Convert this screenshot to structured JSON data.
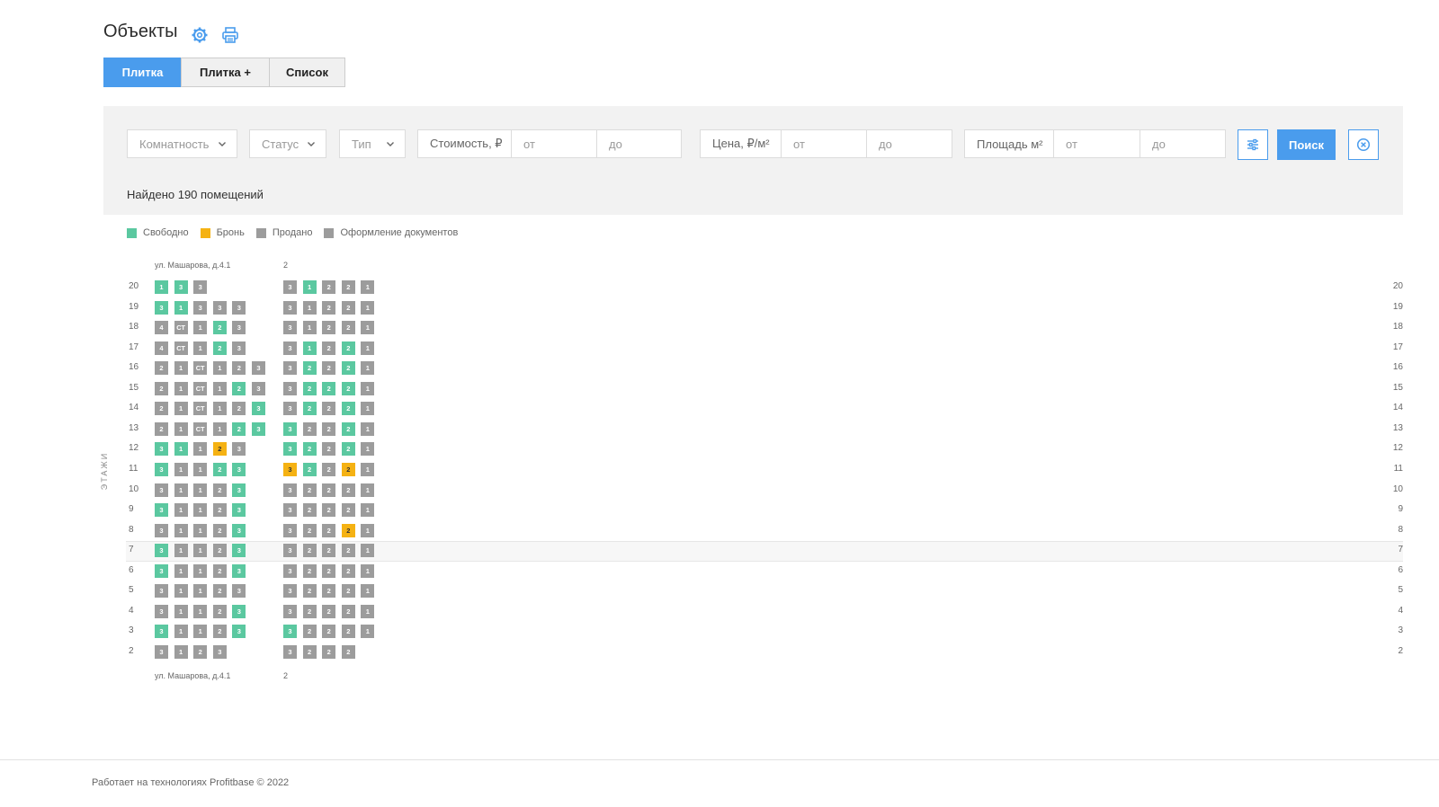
{
  "header": {
    "title": "Объекты",
    "icons": [
      "gear-icon",
      "printer-icon"
    ]
  },
  "tabs": [
    {
      "label": "Плитка",
      "active": true
    },
    {
      "label": "Плитка +",
      "active": false
    },
    {
      "label": "Список",
      "active": false
    }
  ],
  "filters": {
    "rooms": "Комнатность",
    "status": "Статус",
    "type": "Тип",
    "cost_label": "Стоимость, ₽",
    "cost_from": "от",
    "cost_to": "до",
    "price_label": "Цена, ₽/м²",
    "price_from": "от",
    "price_to": "до",
    "area_label": "Площадь м²",
    "area_from": "от",
    "area_to": "до",
    "search_button": "Поиск",
    "settings_icon": "sliders-icon",
    "reset_icon": "close-circle-icon"
  },
  "found_text": "Найдено 190 помещений",
  "legend": [
    {
      "label": "Свободно",
      "color": "#5bc8a0"
    },
    {
      "label": "Бронь",
      "color": "#f5b213"
    },
    {
      "label": "Продано",
      "color": "#9c9c9c"
    },
    {
      "label": "Оформление документов",
      "color": "#9c9c9c"
    }
  ],
  "colors": {
    "accent": "#4a9ced",
    "free": "#5bc8a0",
    "booked": "#f5b213",
    "sold": "#9c9c9c"
  },
  "board": {
    "axis_label": "ЭТАЖИ",
    "sections": [
      {
        "address": "ул. Машарова, д.4.1"
      },
      {
        "address": "2"
      }
    ],
    "floors": [
      {
        "floor": "20",
        "s1": [
          [
            "1",
            "F"
          ],
          [
            "3",
            "F"
          ],
          [
            "3",
            "S"
          ]
        ],
        "s2": [
          [
            "3",
            "S"
          ],
          [
            "1",
            "F"
          ],
          [
            "2",
            "S"
          ],
          [
            "2",
            "S"
          ],
          [
            "1",
            "S"
          ]
        ]
      },
      {
        "floor": "19",
        "s1": [
          [
            "3",
            "F"
          ],
          [
            "1",
            "F"
          ],
          [
            "3",
            "S"
          ],
          [
            "3",
            "S"
          ],
          [
            "3",
            "S"
          ]
        ],
        "s2": [
          [
            "3",
            "S"
          ],
          [
            "1",
            "S"
          ],
          [
            "2",
            "S"
          ],
          [
            "2",
            "S"
          ],
          [
            "1",
            "S"
          ]
        ]
      },
      {
        "floor": "18",
        "s1": [
          [
            "4",
            "S"
          ],
          [
            "СТ",
            "S"
          ],
          [
            "1",
            "S"
          ],
          [
            "2",
            "F"
          ],
          [
            "3",
            "S"
          ]
        ],
        "s2": [
          [
            "3",
            "S"
          ],
          [
            "1",
            "S"
          ],
          [
            "2",
            "S"
          ],
          [
            "2",
            "S"
          ],
          [
            "1",
            "S"
          ]
        ]
      },
      {
        "floor": "17",
        "s1": [
          [
            "4",
            "S"
          ],
          [
            "СТ",
            "S"
          ],
          [
            "1",
            "S"
          ],
          [
            "2",
            "F"
          ],
          [
            "3",
            "S"
          ]
        ],
        "s2": [
          [
            "3",
            "S"
          ],
          [
            "1",
            "F"
          ],
          [
            "2",
            "S"
          ],
          [
            "2",
            "F"
          ],
          [
            "1",
            "S"
          ]
        ]
      },
      {
        "floor": "16",
        "s1": [
          [
            "2",
            "S"
          ],
          [
            "1",
            "S"
          ],
          [
            "СТ",
            "S"
          ],
          [
            "1",
            "S"
          ],
          [
            "2",
            "S"
          ],
          [
            "3",
            "S"
          ]
        ],
        "s2": [
          [
            "3",
            "S"
          ],
          [
            "2",
            "F"
          ],
          [
            "2",
            "S"
          ],
          [
            "2",
            "F"
          ],
          [
            "1",
            "S"
          ]
        ]
      },
      {
        "floor": "15",
        "s1": [
          [
            "2",
            "S"
          ],
          [
            "1",
            "S"
          ],
          [
            "СТ",
            "S"
          ],
          [
            "1",
            "S"
          ],
          [
            "2",
            "F"
          ],
          [
            "3",
            "S"
          ]
        ],
        "s2": [
          [
            "3",
            "S"
          ],
          [
            "2",
            "F"
          ],
          [
            "2",
            "F"
          ],
          [
            "2",
            "F"
          ],
          [
            "1",
            "S"
          ]
        ]
      },
      {
        "floor": "14",
        "s1": [
          [
            "2",
            "S"
          ],
          [
            "1",
            "S"
          ],
          [
            "СТ",
            "S"
          ],
          [
            "1",
            "S"
          ],
          [
            "2",
            "S"
          ],
          [
            "3",
            "F"
          ]
        ],
        "s2": [
          [
            "3",
            "S"
          ],
          [
            "2",
            "F"
          ],
          [
            "2",
            "S"
          ],
          [
            "2",
            "F"
          ],
          [
            "1",
            "S"
          ]
        ]
      },
      {
        "floor": "13",
        "s1": [
          [
            "2",
            "S"
          ],
          [
            "1",
            "S"
          ],
          [
            "СТ",
            "S"
          ],
          [
            "1",
            "S"
          ],
          [
            "2",
            "F"
          ],
          [
            "3",
            "F"
          ]
        ],
        "s2": [
          [
            "3",
            "F"
          ],
          [
            "2",
            "S"
          ],
          [
            "2",
            "S"
          ],
          [
            "2",
            "F"
          ],
          [
            "1",
            "S"
          ]
        ]
      },
      {
        "floor": "12",
        "s1": [
          [
            "3",
            "F"
          ],
          [
            "1",
            "F"
          ],
          [
            "1",
            "S"
          ],
          [
            "2",
            "B"
          ],
          [
            "3",
            "S"
          ]
        ],
        "s2": [
          [
            "3",
            "F"
          ],
          [
            "2",
            "F"
          ],
          [
            "2",
            "S"
          ],
          [
            "2",
            "F"
          ],
          [
            "1",
            "S"
          ]
        ]
      },
      {
        "floor": "11",
        "s1": [
          [
            "3",
            "F"
          ],
          [
            "1",
            "S"
          ],
          [
            "1",
            "S"
          ],
          [
            "2",
            "F"
          ],
          [
            "3",
            "F"
          ]
        ],
        "s2": [
          [
            "3",
            "B"
          ],
          [
            "2",
            "F"
          ],
          [
            "2",
            "S"
          ],
          [
            "2",
            "B"
          ],
          [
            "1",
            "S"
          ]
        ]
      },
      {
        "floor": "10",
        "s1": [
          [
            "3",
            "S"
          ],
          [
            "1",
            "S"
          ],
          [
            "1",
            "S"
          ],
          [
            "2",
            "S"
          ],
          [
            "3",
            "F"
          ]
        ],
        "s2": [
          [
            "3",
            "S"
          ],
          [
            "2",
            "S"
          ],
          [
            "2",
            "S"
          ],
          [
            "2",
            "S"
          ],
          [
            "1",
            "S"
          ]
        ]
      },
      {
        "floor": "9",
        "s1": [
          [
            "3",
            "F"
          ],
          [
            "1",
            "S"
          ],
          [
            "1",
            "S"
          ],
          [
            "2",
            "S"
          ],
          [
            "3",
            "F"
          ]
        ],
        "s2": [
          [
            "3",
            "S"
          ],
          [
            "2",
            "S"
          ],
          [
            "2",
            "S"
          ],
          [
            "2",
            "S"
          ],
          [
            "1",
            "S"
          ]
        ]
      },
      {
        "floor": "8",
        "s1": [
          [
            "3",
            "S"
          ],
          [
            "1",
            "S"
          ],
          [
            "1",
            "S"
          ],
          [
            "2",
            "S"
          ],
          [
            "3",
            "F"
          ]
        ],
        "s2": [
          [
            "3",
            "S"
          ],
          [
            "2",
            "S"
          ],
          [
            "2",
            "S"
          ],
          [
            "2",
            "B"
          ],
          [
            "1",
            "S"
          ]
        ]
      },
      {
        "floor": "7",
        "s1": [
          [
            "3",
            "F"
          ],
          [
            "1",
            "S"
          ],
          [
            "1",
            "S"
          ],
          [
            "2",
            "S"
          ],
          [
            "3",
            "F"
          ]
        ],
        "s2": [
          [
            "3",
            "S"
          ],
          [
            "2",
            "S"
          ],
          [
            "2",
            "S"
          ],
          [
            "2",
            "S"
          ],
          [
            "1",
            "S"
          ]
        ]
      },
      {
        "floor": "6",
        "s1": [
          [
            "3",
            "F"
          ],
          [
            "1",
            "S"
          ],
          [
            "1",
            "S"
          ],
          [
            "2",
            "S"
          ],
          [
            "3",
            "F"
          ]
        ],
        "s2": [
          [
            "3",
            "S"
          ],
          [
            "2",
            "S"
          ],
          [
            "2",
            "S"
          ],
          [
            "2",
            "S"
          ],
          [
            "1",
            "S"
          ]
        ]
      },
      {
        "floor": "5",
        "s1": [
          [
            "3",
            "S"
          ],
          [
            "1",
            "S"
          ],
          [
            "1",
            "S"
          ],
          [
            "2",
            "S"
          ],
          [
            "3",
            "S"
          ]
        ],
        "s2": [
          [
            "3",
            "S"
          ],
          [
            "2",
            "S"
          ],
          [
            "2",
            "S"
          ],
          [
            "2",
            "S"
          ],
          [
            "1",
            "S"
          ]
        ]
      },
      {
        "floor": "4",
        "s1": [
          [
            "3",
            "S"
          ],
          [
            "1",
            "S"
          ],
          [
            "1",
            "S"
          ],
          [
            "2",
            "S"
          ],
          [
            "3",
            "F"
          ]
        ],
        "s2": [
          [
            "3",
            "S"
          ],
          [
            "2",
            "S"
          ],
          [
            "2",
            "S"
          ],
          [
            "2",
            "S"
          ],
          [
            "1",
            "S"
          ]
        ]
      },
      {
        "floor": "3",
        "s1": [
          [
            "3",
            "F"
          ],
          [
            "1",
            "S"
          ],
          [
            "1",
            "S"
          ],
          [
            "2",
            "S"
          ],
          [
            "3",
            "F"
          ]
        ],
        "s2": [
          [
            "3",
            "F"
          ],
          [
            "2",
            "S"
          ],
          [
            "2",
            "S"
          ],
          [
            "2",
            "S"
          ],
          [
            "1",
            "S"
          ]
        ]
      },
      {
        "floor": "2",
        "s1": [
          [
            "3",
            "S"
          ],
          [
            "1",
            "S"
          ],
          [
            "2",
            "S"
          ],
          [
            "3",
            "S"
          ]
        ],
        "s2": [
          [
            "3",
            "S"
          ],
          [
            "2",
            "S"
          ],
          [
            "2",
            "S"
          ],
          [
            "2",
            "S"
          ]
        ]
      }
    ]
  },
  "footer": "Работает на технологиях Profitbase © 2022"
}
